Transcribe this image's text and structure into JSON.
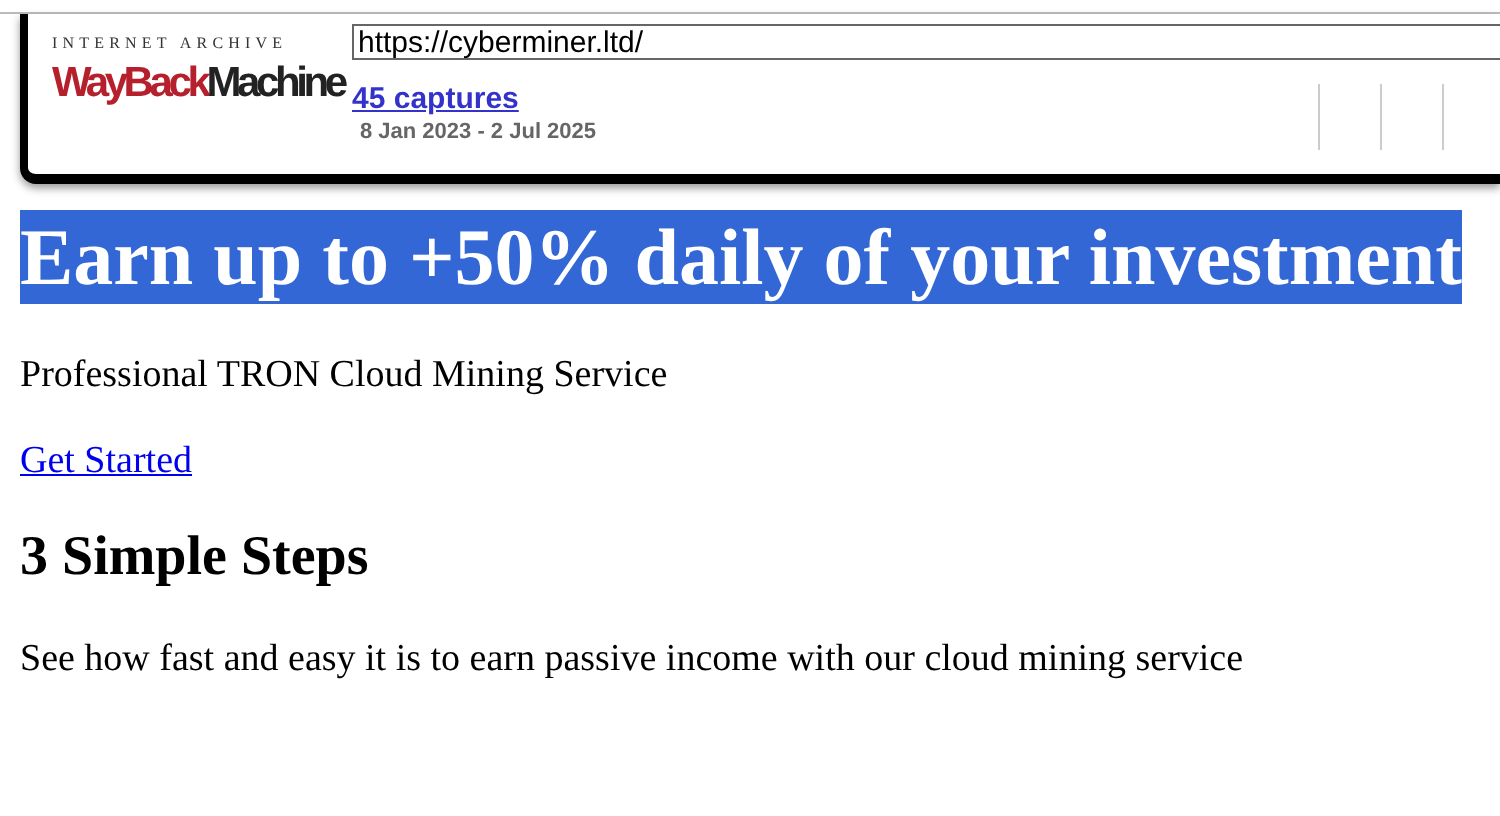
{
  "toolbar": {
    "logo": {
      "top": "INTERNET ARCHIVE",
      "wayback": "WayBack",
      "machine": "Machine"
    },
    "url": "https://cyberminer.ltd/",
    "captures": "45 captures",
    "date_range": "8 Jan 2023 - 2 Jul 2025"
  },
  "page": {
    "headline": "Earn up to +50% daily of your investment",
    "headline_selected": true,
    "subtitle": "Professional TRON Cloud Mining Service",
    "cta": "Get Started",
    "steps_heading": "3 Simple Steps",
    "steps_text": "See how fast and easy it is to earn passive income with our cloud mining service"
  }
}
